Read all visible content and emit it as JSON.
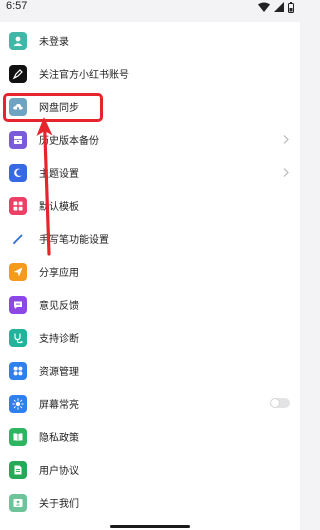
{
  "status_bar": {
    "time": "6:57"
  },
  "menu": [
    {
      "id": "login",
      "label": "未登录",
      "icon": "user-avatar-icon",
      "color": "#40b7a7",
      "trailing": "none"
    },
    {
      "id": "follow",
      "label": "关注官方小红书账号",
      "icon": "pen-nib-icon",
      "color": "#111111",
      "trailing": "none"
    },
    {
      "id": "sync",
      "label": "网盘同步",
      "icon": "cloud-folder-icon",
      "color": "#6fa3c2",
      "trailing": "none"
    },
    {
      "id": "backup",
      "label": "历史版本备份",
      "icon": "backup-box-icon",
      "color": "#7a5bd9",
      "trailing": "chevron"
    },
    {
      "id": "theme",
      "label": "主题设置",
      "icon": "moon-icon",
      "color": "#3768e6",
      "trailing": "chevron"
    },
    {
      "id": "template",
      "label": "默认模板",
      "icon": "template-grid-icon",
      "color": "#ee3f66",
      "trailing": "none"
    },
    {
      "id": "pen",
      "label": "手写笔功能设置",
      "icon": "stylus-icon",
      "color": "#ffffff",
      "trailing": "none"
    },
    {
      "id": "share",
      "label": "分享应用",
      "icon": "share-arrow-icon",
      "color": "#f59a1c",
      "trailing": "none"
    },
    {
      "id": "feedback",
      "label": "意见反馈",
      "icon": "chat-bubble-icon",
      "color": "#8b47e8",
      "trailing": "none"
    },
    {
      "id": "diagnose",
      "label": "支持诊断",
      "icon": "stethoscope-icon",
      "color": "#21b49a",
      "trailing": "none"
    },
    {
      "id": "resources",
      "label": "资源管理",
      "icon": "four-squares-icon",
      "color": "#2f80ef",
      "trailing": "none"
    },
    {
      "id": "screen",
      "label": "屏幕常亮",
      "icon": "sun-icon",
      "color": "#2f80ef",
      "trailing": "toggle"
    },
    {
      "id": "privacy",
      "label": "隐私政策",
      "icon": "open-book-icon",
      "color": "#2db562",
      "trailing": "none"
    },
    {
      "id": "agreement",
      "label": "用户协议",
      "icon": "document-icon",
      "color": "#26a956",
      "trailing": "none"
    },
    {
      "id": "about",
      "label": "关于我们",
      "icon": "user-card-icon",
      "color": "#6dc49a",
      "trailing": "none"
    }
  ],
  "screen_awake_enabled": false,
  "annotation": {
    "highlight_color": "#e5252b",
    "highlighted_item": "网盘同步"
  }
}
